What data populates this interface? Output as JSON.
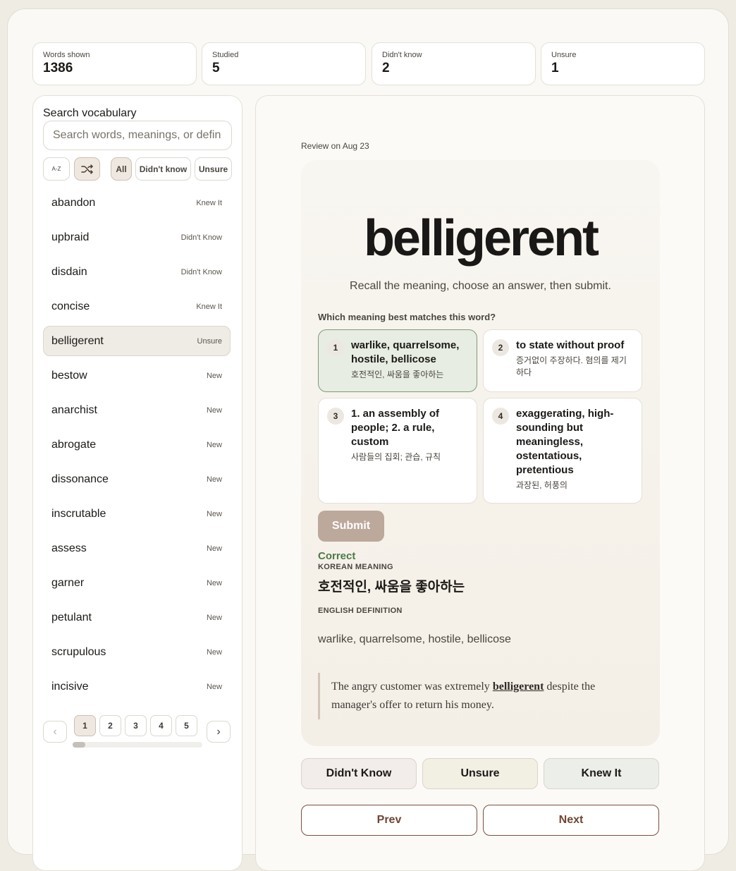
{
  "stats": [
    {
      "label": "Words shown",
      "value": "1386"
    },
    {
      "label": "Studied",
      "value": "5"
    },
    {
      "label": "Didn't know",
      "value": "2"
    },
    {
      "label": "Unsure",
      "value": "1"
    }
  ],
  "sidebar": {
    "search_label": "Search vocabulary",
    "search_placeholder": "Search words, meanings, or defin",
    "sort_az": "A-Z",
    "shuffle_icon": "shuffle-icon",
    "filters": [
      "All",
      "Didn't know",
      "Unsure"
    ],
    "active_filter": "All",
    "items": [
      {
        "word": "abandon",
        "status": "Knew It"
      },
      {
        "word": "upbraid",
        "status": "Didn't Know"
      },
      {
        "word": "disdain",
        "status": "Didn't Know"
      },
      {
        "word": "concise",
        "status": "Knew It"
      },
      {
        "word": "belligerent",
        "status": "Unsure"
      },
      {
        "word": "bestow",
        "status": "New"
      },
      {
        "word": "anarchist",
        "status": "New"
      },
      {
        "word": "abrogate",
        "status": "New"
      },
      {
        "word": "dissonance",
        "status": "New"
      },
      {
        "word": "inscrutable",
        "status": "New"
      },
      {
        "word": "assess",
        "status": "New"
      },
      {
        "word": "garner",
        "status": "New"
      },
      {
        "word": "petulant",
        "status": "New"
      },
      {
        "word": "scrupulous",
        "status": "New"
      },
      {
        "word": "incisive",
        "status": "New"
      }
    ],
    "selected_word": "belligerent",
    "pages": [
      "1",
      "2",
      "3",
      "4",
      "5"
    ],
    "current_page": "1"
  },
  "card": {
    "review_label": "Review on Aug 23",
    "word": "belligerent",
    "hint": "Recall the meaning, choose an answer, then submit.",
    "question": "Which meaning best matches this word?",
    "options": [
      {
        "num": "1",
        "en": "warlike, quarrelsome, hostile, bellicose",
        "ko": "호전적인, 싸움을 좋아하는"
      },
      {
        "num": "2",
        "en": "to state without proof",
        "ko": "증거없이 주장하다. 혐의를 제기하다"
      },
      {
        "num": "3",
        "en": "1. an assembly of people; 2. a rule, custom",
        "ko": "사람들의 집회; 관습, 규칙"
      },
      {
        "num": "4",
        "en": "exaggerating, high-sounding but meaningless, ostentatious, pretentious",
        "ko": "과장된, 허풍의"
      }
    ],
    "selected_option": "1",
    "submit_label": "Submit",
    "result": "Correct",
    "korean_label": "KOREAN MEANING",
    "korean_value": "호전적인, 싸움을 좋아하는",
    "english_label": "ENGLISH DEFINITION",
    "english_value": "warlike, quarrelsome, hostile, bellicose",
    "example_before": "The angry customer was extremely ",
    "example_word": "belligerent",
    "example_after": " despite the manager's offer to return his money."
  },
  "rating": {
    "didnt_know": "Didn't Know",
    "unsure": "Unsure",
    "knew_it": "Knew It"
  },
  "nav": {
    "prev": "Prev",
    "next": "Next"
  },
  "colors": {
    "accent": "#6e4634",
    "correct": "#4c7a46",
    "selected_option_bg": "#e7ede2",
    "submit_bg": "#bca99c"
  }
}
